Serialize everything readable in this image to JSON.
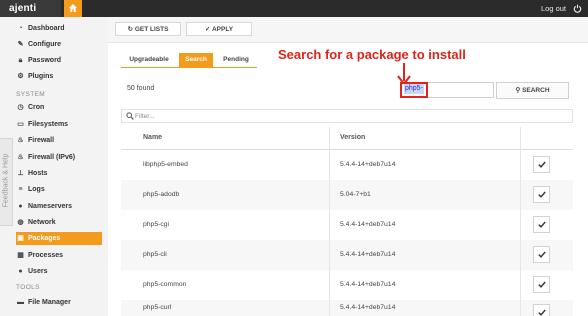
{
  "app": {
    "brand": "ajenti",
    "logout_label": "Log out"
  },
  "sidebar": {
    "items": [
      {
        "label": "Dashboard",
        "icon": "dashboard-icon"
      },
      {
        "label": "Configure",
        "icon": "wrench-icon"
      },
      {
        "label": "Password",
        "icon": "lock-icon"
      },
      {
        "label": "Plugins",
        "icon": "gears-icon"
      }
    ],
    "system_label": "SYSTEM",
    "system_items": [
      {
        "label": "Cron",
        "icon": "clock-icon"
      },
      {
        "label": "Filesystems",
        "icon": "hdd-icon"
      },
      {
        "label": "Firewall",
        "icon": "fire-icon"
      },
      {
        "label": "Firewall (IPv6)",
        "icon": "fire-icon"
      },
      {
        "label": "Hosts",
        "icon": "sitemap-icon"
      },
      {
        "label": "Logs",
        "icon": "list-icon"
      },
      {
        "label": "Nameservers",
        "icon": "group-icon"
      },
      {
        "label": "Network",
        "icon": "globe-icon"
      },
      {
        "label": "Packages",
        "icon": "gift-icon",
        "active": true
      },
      {
        "label": "Processes",
        "icon": "th-icon"
      },
      {
        "label": "Users",
        "icon": "user-icon"
      }
    ],
    "tools_label": "TOOLS",
    "tools_items": [
      {
        "label": "File Manager",
        "icon": "folder-icon"
      }
    ]
  },
  "feedback_label": "Feedback & Help",
  "toolbar": {
    "get_lists_label": "GET LISTS",
    "apply_label": "APPLY"
  },
  "tabs": [
    "Upgradeable",
    "Search",
    "Pending"
  ],
  "annotation": "Search for a package to install",
  "search": {
    "found_text": "50 found",
    "query": "php5-",
    "button_label": "SEARCH"
  },
  "filter_placeholder": "Filter...",
  "table": {
    "headers": {
      "name": "Name",
      "version": "Version"
    },
    "rows": [
      {
        "name": "libphp5-embed",
        "version": "5.4.4-14+deb7u14"
      },
      {
        "name": "php5-adodb",
        "version": "5.04-7+b1"
      },
      {
        "name": "php5-cgi",
        "version": "5.4.4-14+deb7u14"
      },
      {
        "name": "php5-cli",
        "version": "5.4.4-14+deb7u14"
      },
      {
        "name": "php5-common",
        "version": "5.4.4-14+deb7u14"
      },
      {
        "name": "php5-curl",
        "version": "5.4.4-14+deb7u14"
      }
    ]
  },
  "colors": {
    "accent": "#f29b1c",
    "annotation": "#e0241b",
    "topbar": "#2b2b2b"
  }
}
